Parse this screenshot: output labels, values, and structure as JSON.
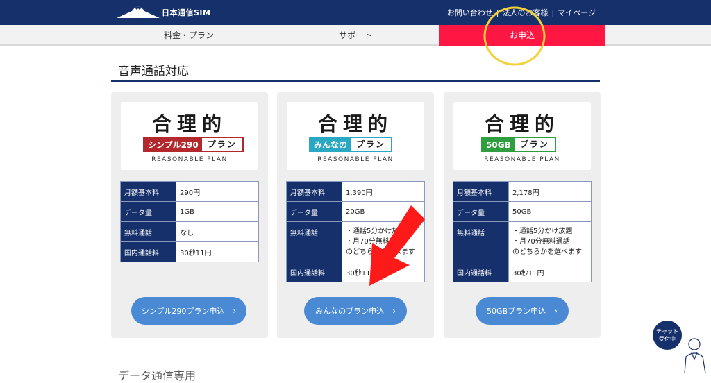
{
  "header": {
    "brand": "日本通信SIM",
    "links": [
      "お問い合わせ",
      "法人のお客様",
      "マイページ"
    ],
    "separator": "|"
  },
  "nav": {
    "items": [
      "料金・プラン",
      "サポート",
      "お申込"
    ],
    "active_color": "#ff1744"
  },
  "section": {
    "title": "音声通話対応"
  },
  "cards": [
    {
      "brand_kanji": "合理的",
      "badge_main": "シンプル290",
      "badge_suffix": "プラン",
      "subtitle": "REASONABLE PLAN",
      "rows": [
        {
          "key": "月額基本料",
          "value": "290円"
        },
        {
          "key": "データ量",
          "value": "1GB"
        },
        {
          "key": "無料通話",
          "value": "なし"
        },
        {
          "key": "国内通話料",
          "value": "30秒11円"
        }
      ],
      "button": "シンプル290プラン申込",
      "accent": "#b3282d"
    },
    {
      "brand_kanji": "合理的",
      "badge_main": "みんなの",
      "badge_suffix": "プラン",
      "subtitle": "REASONABLE PLAN",
      "rows": [
        {
          "key": "月額基本料",
          "value": "1,390円"
        },
        {
          "key": "データ量",
          "value": "20GB"
        },
        {
          "key": "無料通話",
          "value": "・通話5分かけ放題",
          "value2": "・月70分無料通話",
          "value3": "のどちらかを選べます"
        },
        {
          "key": "国内通話料",
          "value": "30秒11円"
        }
      ],
      "button": "みんなのプラン申込",
      "accent": "#29a8c4"
    },
    {
      "brand_kanji": "合理的",
      "badge_main": "50GB",
      "badge_suffix": "プラン",
      "subtitle": "REASONABLE PLAN",
      "rows": [
        {
          "key": "月額基本料",
          "value": "2,178円"
        },
        {
          "key": "データ量",
          "value": "50GB"
        },
        {
          "key": "無料通話",
          "value": "・通話5分かけ放題",
          "value2": "・月70分無料通話",
          "value3": "のどちらかを選べます"
        },
        {
          "key": "国内通話料",
          "value": "30秒11円"
        }
      ],
      "button": "50GBプラン申込",
      "accent": "#2e9e3e"
    }
  ],
  "next_section": {
    "title": "データ通信専用"
  },
  "chat": {
    "line1": "チャット",
    "line2": "受付中"
  },
  "colors": {
    "navy": "#16306b",
    "button": "#4a8ad4",
    "annotation_red": "#ff1a1a",
    "annotation_yellow": "#f2d13a"
  }
}
